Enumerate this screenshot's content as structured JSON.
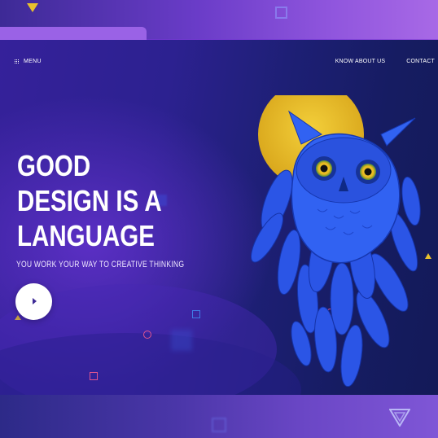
{
  "nav": {
    "menu_label": "MENU",
    "links": [
      "KNOW ABOUT US",
      "CONTACT"
    ]
  },
  "hero": {
    "headline_lines": [
      "GOOD",
      "DESIGN IS A",
      "LANGUAGE"
    ],
    "tagline": "YOU WORK YOUR WAY TO CREATIVE THINKING"
  },
  "icons": {
    "menu": "grid-menu-icon",
    "play": "play-icon",
    "illustration": "owl-moon-illustration"
  },
  "colors": {
    "accent_yellow": "#e8c12d",
    "owl_blue": "#2f5cf0",
    "background_dark": "#1d1f74",
    "background_purple": "#7a3fd6"
  }
}
